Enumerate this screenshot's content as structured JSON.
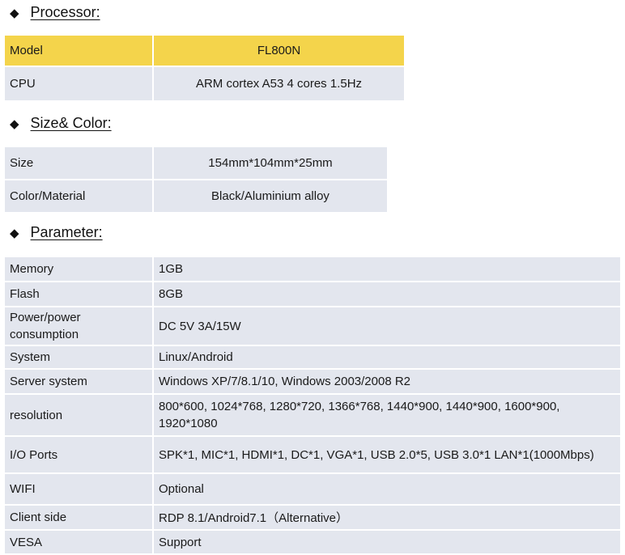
{
  "sections": {
    "processor": {
      "title": "Processor:",
      "rows": [
        {
          "label": "Model",
          "value": "FL800N"
        },
        {
          "label": "CPU",
          "value": "ARM cortex A53  4 cores  1.5Hz"
        }
      ]
    },
    "size_color": {
      "title": "Size& Color:",
      "rows": [
        {
          "label": "Size",
          "value": "154mm*104mm*25mm"
        },
        {
          "label": "Color/Material",
          "value": "Black/Aluminium alloy"
        }
      ]
    },
    "parameter": {
      "title": "Parameter:",
      "rows": [
        {
          "label": "Memory",
          "value": "1GB"
        },
        {
          "label": "Flash",
          "value": "8GB"
        },
        {
          "label": "Power/power consumption",
          "value": "DC 5V 3A/15W"
        },
        {
          "label": "System",
          "value": "Linux/Android"
        },
        {
          "label": "Server system",
          "value": "Windows XP/7/8.1/10,  Windows 2003/2008 R2"
        },
        {
          "label": "resolution",
          "value": "800*600,  1024*768, 1280*720, 1366*768, 1440*900,  1440*900,   1600*900,  1920*1080"
        },
        {
          "label": "I/O Ports",
          "value": "SPK*1,  MIC*1,  HDMI*1, DC*1, VGA*1,  USB 2.0*5, USB 3.0*1 LAN*1(1000Mbps)"
        },
        {
          "label": "WIFI",
          "value": "Optional"
        },
        {
          "label": "Client side",
          "value": "RDP 8.1/Android7.1（Alternative）"
        },
        {
          "label": "VESA",
          "value": "Support"
        }
      ]
    }
  },
  "icons": {
    "bullet": "diamond-bullet-icon"
  },
  "colors": {
    "highlight_row": "#f4d44b",
    "row_bg": "#e3e6ee"
  }
}
